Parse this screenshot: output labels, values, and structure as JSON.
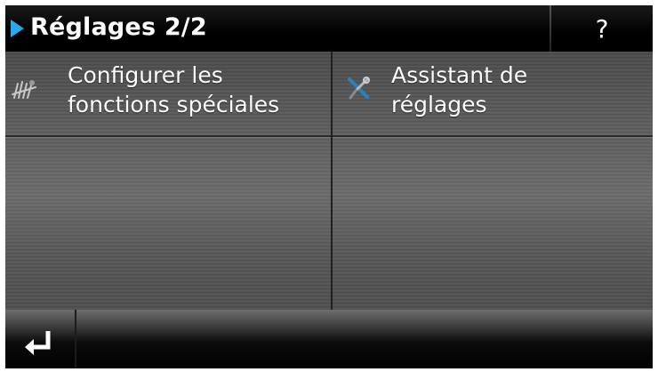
{
  "header": {
    "title": "Réglages 2/2",
    "help_label": "?"
  },
  "menu": {
    "items": [
      {
        "label_line1": "Configurer les",
        "label_line2": "fonctions spéciales",
        "icon": "special-functions-icon"
      },
      {
        "label_line1": "Assistant de",
        "label_line2": "réglages",
        "icon": "tools-icon"
      }
    ]
  },
  "footer": {
    "back_icon": "return-arrow-icon"
  },
  "colors": {
    "accent": "#2aa8e8",
    "text": "#ffffff",
    "header_bg": "#000000"
  }
}
